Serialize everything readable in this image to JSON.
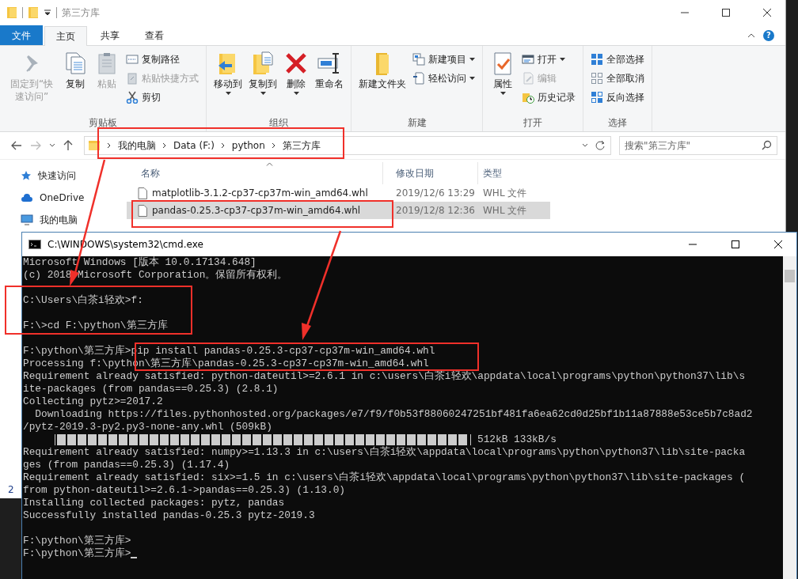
{
  "explorer": {
    "title": "第三方库",
    "tabs": [
      {
        "label": "文件",
        "kind": "file",
        "selected": false
      },
      {
        "label": "主页",
        "kind": "tab",
        "selected": true
      },
      {
        "label": "共享",
        "kind": "tab",
        "selected": false
      },
      {
        "label": "查看",
        "kind": "tab",
        "selected": false
      }
    ],
    "help": "?",
    "ribbon": [
      {
        "label": "剪贴板",
        "large": [
          {
            "label": "固定到“快速访问”",
            "disabled": true,
            "dropdown": false
          },
          {
            "label": "复制",
            "disabled": false,
            "dropdown": false
          },
          {
            "label": "粘贴",
            "disabled": true,
            "dropdown": false
          }
        ],
        "small": [
          {
            "label": "复制路径",
            "disabled": false,
            "dropdown": false
          },
          {
            "label": "粘贴快捷方式",
            "disabled": true,
            "dropdown": false
          },
          {
            "label": "剪切",
            "disabled": false,
            "dropdown": false
          }
        ]
      },
      {
        "label": "组织",
        "large": [
          {
            "label": "移动到",
            "disabled": false,
            "dropdown": true
          },
          {
            "label": "复制到",
            "disabled": false,
            "dropdown": true
          },
          {
            "label": "删除",
            "disabled": false,
            "dropdown": true
          },
          {
            "label": "重命名",
            "disabled": false,
            "dropdown": false
          }
        ]
      },
      {
        "label": "新建",
        "large": [
          {
            "label": "新建文件夹",
            "disabled": false,
            "dropdown": false
          }
        ],
        "small": [
          {
            "label": "新建项目",
            "disabled": false,
            "dropdown": true
          },
          {
            "label": "轻松访问",
            "disabled": false,
            "dropdown": true
          }
        ]
      },
      {
        "label": "打开",
        "large": [
          {
            "label": "属性",
            "disabled": false,
            "dropdown": true
          }
        ],
        "small": [
          {
            "label": "打开",
            "disabled": false,
            "dropdown": true
          },
          {
            "label": "编辑",
            "disabled": true,
            "dropdown": false
          },
          {
            "label": "历史记录",
            "disabled": false,
            "dropdown": false
          }
        ]
      },
      {
        "label": "选择",
        "small": [
          {
            "label": "全部选择",
            "disabled": false,
            "dropdown": false
          },
          {
            "label": "全部取消",
            "disabled": false,
            "dropdown": false
          },
          {
            "label": "反向选择",
            "disabled": false,
            "dropdown": false
          }
        ]
      }
    ],
    "breadcrumbs": [
      "我的电脑",
      "Data (F:)",
      "python",
      "第三方库"
    ],
    "search": {
      "placeholder": "搜索\"第三方库\""
    },
    "sidebar": [
      {
        "label": "快速访问"
      },
      {
        "label": "OneDrive"
      },
      {
        "label": "我的电脑"
      }
    ],
    "columns": [
      "名称",
      "修改日期",
      "类型"
    ],
    "rows": [
      {
        "name": "matplotlib-3.1.2-cp37-cp37m-win_amd64.whl",
        "date": "2019/12/6 13:29",
        "type": "WHL 文件",
        "selected": false
      },
      {
        "name": "pandas-0.25.3-cp37-cp37m-win_amd64.whl",
        "date": "2019/12/8 12:36",
        "type": "WHL 文件",
        "selected": true
      }
    ],
    "status_bar": "2"
  },
  "cmd": {
    "title": "C:\\WINDOWS\\system32\\cmd.exe",
    "cursor": true,
    "lines": [
      {
        "kind": "text",
        "text": "Microsoft Windows [版本 10.0.17134.648]"
      },
      {
        "kind": "text",
        "text": "(c) 2018 Microsoft Corporation。保留所有权利。"
      },
      {
        "kind": "blank"
      },
      {
        "kind": "text",
        "text": "C:\\Users\\白茶i轻欢>f:"
      },
      {
        "kind": "blank"
      },
      {
        "kind": "text",
        "text": "F:\\>cd F:\\python\\第三方库"
      },
      {
        "kind": "blank"
      },
      {
        "kind": "text",
        "text": "F:\\python\\第三方库>pip install pandas-0.25.3-cp37-cp37m-win_amd64.whl"
      },
      {
        "kind": "text",
        "text": "Processing f:\\python\\第三方库\\pandas-0.25.3-cp37-cp37m-win_amd64.whl"
      },
      {
        "kind": "text",
        "text": "Requirement already satisfied: python-dateutil>=2.6.1 in c:\\users\\白茶i轻欢\\appdata\\local\\programs\\python\\python37\\lib\\s"
      },
      {
        "kind": "text",
        "text": "ite-packages (from pandas==0.25.3) (2.8.1)"
      },
      {
        "kind": "text",
        "text": "Collecting pytz>=2017.2"
      },
      {
        "kind": "text",
        "text": "  Downloading https://files.pythonhosted.org/packages/e7/f9/f0b53f88060247251bf481fa6ea62cd0d25bf1b11a87888e53ce5b7c8ad2"
      },
      {
        "kind": "text",
        "text": "/pytz-2019.3-py2.py3-none-any.whl (509kB)"
      },
      {
        "kind": "progress",
        "level": 1,
        "reading": "512kB 133kB/s"
      },
      {
        "kind": "text",
        "text": "Requirement already satisfied: numpy>=1.13.3 in c:\\users\\白茶i轻欢\\appdata\\local\\programs\\python\\python37\\lib\\site-packa"
      },
      {
        "kind": "text",
        "text": "ges (from pandas==0.25.3) (1.17.4)"
      },
      {
        "kind": "text",
        "text": "Requirement already satisfied: six>=1.5 in c:\\users\\白茶i轻欢\\appdata\\local\\programs\\python\\python37\\lib\\site-packages ("
      },
      {
        "kind": "text",
        "text": "from python-dateutil>=2.6.1->pandas==0.25.3) (1.13.0)"
      },
      {
        "kind": "text",
        "text": "Installing collected packages: pytz, pandas"
      },
      {
        "kind": "text",
        "text": "Successfully installed pandas-0.25.3 pytz-2019.3"
      },
      {
        "kind": "blank"
      },
      {
        "kind": "text",
        "text": "F:\\python\\第三方库>"
      },
      {
        "kind": "text",
        "text": "F:\\python\\第三方库>"
      }
    ]
  }
}
